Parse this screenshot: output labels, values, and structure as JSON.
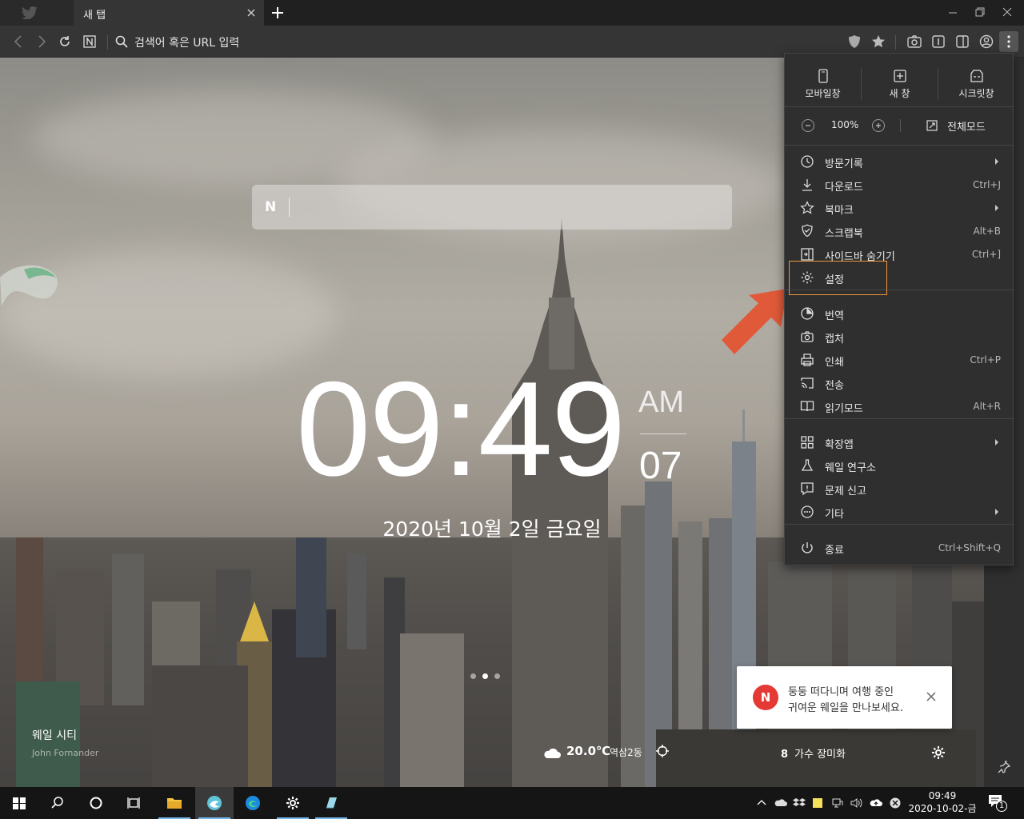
{
  "browser": {
    "tab_title": "새 탭",
    "address_placeholder": "검색어 혹은 URL 입력"
  },
  "newtab": {
    "clock": {
      "time": "09:49",
      "ampm": "AM",
      "seconds": "07"
    },
    "date": "2020년 10월 2일 금요일",
    "background": {
      "title": "웨일 시티",
      "author": "John Fornander"
    },
    "weather": {
      "temp": "20.0℃",
      "location": "역삼2동"
    },
    "trend": {
      "rank": "8",
      "keyword": "가수 장미화"
    },
    "toast": {
      "line1": "둥둥 떠다니며 여행 중인",
      "line2": "귀여운 웨일을 만나보세요.",
      "badge": "N"
    }
  },
  "menu": {
    "top": [
      {
        "label": "모바일창",
        "icon": "mobile-window-icon"
      },
      {
        "label": "새 창",
        "icon": "new-window-icon"
      },
      {
        "label": "시크릿창",
        "icon": "secret-window-icon"
      }
    ],
    "zoom": {
      "value": "100%",
      "fullscreen": "전체모드"
    },
    "items": [
      {
        "label": "방문기록",
        "shortcut": "",
        "arrow": true,
        "icon": "history-icon"
      },
      {
        "label": "다운로드",
        "shortcut": "Ctrl+J",
        "arrow": false,
        "icon": "download-icon"
      },
      {
        "label": "북마크",
        "shortcut": "",
        "arrow": true,
        "icon": "bookmark-icon"
      },
      {
        "label": "스크랩북",
        "shortcut": "Alt+B",
        "arrow": false,
        "icon": "scrapbook-icon"
      },
      {
        "label": "사이드바 숨기기",
        "shortcut": "Ctrl+]",
        "arrow": false,
        "icon": "sidebar-icon"
      },
      {
        "label": "설정",
        "shortcut": "",
        "arrow": false,
        "icon": "gear-icon"
      },
      {
        "label": "번역",
        "shortcut": "",
        "arrow": false,
        "icon": "translate-icon"
      },
      {
        "label": "캡처",
        "shortcut": "",
        "arrow": false,
        "icon": "camera-icon"
      },
      {
        "label": "인쇄",
        "shortcut": "Ctrl+P",
        "arrow": false,
        "icon": "print-icon"
      },
      {
        "label": "전송",
        "shortcut": "",
        "arrow": false,
        "icon": "cast-icon"
      },
      {
        "label": "읽기모드",
        "shortcut": "Alt+R",
        "arrow": false,
        "icon": "reader-icon"
      },
      {
        "label": "확장앱",
        "shortcut": "",
        "arrow": true,
        "icon": "extensions-icon"
      },
      {
        "label": "웨일 연구소",
        "shortcut": "",
        "arrow": false,
        "icon": "lab-flask-icon"
      },
      {
        "label": "문제 신고",
        "shortcut": "",
        "arrow": false,
        "icon": "report-icon"
      },
      {
        "label": "기타",
        "shortcut": "",
        "arrow": true,
        "icon": "more-icon"
      },
      {
        "label": "종료",
        "shortcut": "Ctrl+Shift+Q",
        "arrow": false,
        "icon": "power-icon"
      }
    ]
  },
  "taskbar": {
    "time": "09:49",
    "date": "2020-10-02-금",
    "notifications": "1"
  },
  "colors": {
    "highlight": "#f0953c",
    "arrow": "#e05a3a",
    "notification_badge": "#e53935"
  }
}
